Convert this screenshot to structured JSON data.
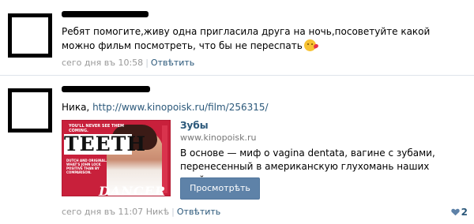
{
  "posts": [
    {
      "text": "Ребят помогите,живу одна пригласила друга на ночь,посоветуйте какой можно фильм посмотреть, что бы не переспать",
      "emoji": "kissing-face-emoji",
      "time": "сего дня въ 10:58",
      "reply_label": "Отвѣтить"
    },
    {
      "text_prefix": "Ника, ",
      "link": "http://www.kinopoisk.ru/film/256315/",
      "attachment": {
        "title": "Зубы",
        "domain": "www.kinopoisk.ru",
        "description": "В основе — миф о vagina dentata, вагине с зубами, перенесенный в американскую глухомань наших дней...",
        "button_label": "Просмотрѣть",
        "thumbnail": {
          "top_text": "YOU'LL NEVER SEE THEM COMING.",
          "title": "TEETH",
          "small_text": "DUTCH AND ORIGINAL. WHAT'S JOHN LOCK POSITIVE THAN BY COMPARISON.",
          "bottom_text": "DANCER"
        }
      },
      "time": "сего дня въ 11:07",
      "reply_to": "Никѣ",
      "reply_label": "Отвѣтить",
      "likes": "2"
    }
  ],
  "colors": {
    "link": "#2b587a",
    "meta": "#999999",
    "button": "#5e82a8"
  }
}
